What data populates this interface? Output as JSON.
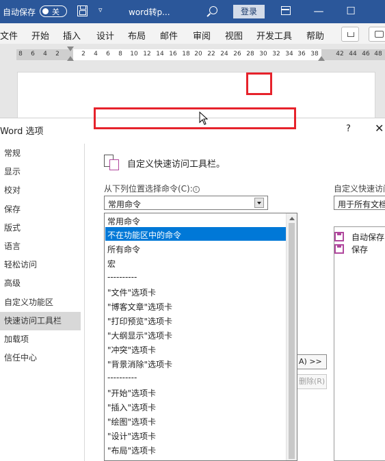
{
  "titlebar": {
    "autosave_label": "自动保存",
    "autosave_state": "关",
    "qat_dropdown": "▿",
    "doc_title": "word转p...",
    "login_label": "登录",
    "minimize": "—",
    "maximize": "☐",
    "bg_color": "#2b579a"
  },
  "menu": {
    "items": [
      "文件",
      "开始",
      "插入",
      "设计",
      "布局",
      "邮件",
      "审阅",
      "视图",
      "开发工具",
      "帮助"
    ]
  },
  "ruler": {
    "numbers": [
      "8",
      "6",
      "4",
      "2",
      "2",
      "4",
      "6",
      "8",
      "10",
      "12",
      "14",
      "16",
      "18",
      "20",
      "22",
      "24",
      "26",
      "28",
      "30",
      "32",
      "34",
      "36",
      "38",
      "42",
      "44",
      "46",
      "48"
    ]
  },
  "dialog": {
    "title": "Word 选项",
    "help": "?",
    "close": "✕",
    "nav": [
      "常规",
      "显示",
      "校对",
      "保存",
      "版式",
      "语言",
      "轻松访问",
      "高级",
      "自定义功能区",
      "快速访问工具栏",
      "加载项",
      "信任中心"
    ],
    "active_nav": "快速访问工具栏",
    "section_title": "自定义快速访问工具栏。",
    "choose_label": "从下列位置选择命令(C):",
    "combo_value": "常用命令",
    "dropdown_items": [
      "常用命令",
      "不在功能区中的命令",
      "所有命令",
      "宏",
      "----------",
      "\"文件\"选项卡",
      "\"博客文章\"选项卡",
      "\"打印预览\"选项卡",
      "\"大纲显示\"选项卡",
      "\"冲突\"选项卡",
      "\"背景消除\"选项卡",
      "----------",
      "\"开始\"选项卡",
      "\"插入\"选项卡",
      "\"绘图\"选项卡",
      "\"设计\"选项卡",
      "\"布局\"选项卡"
    ],
    "selected_item": "不在功能区中的命令",
    "right_label": "自定义快速访问",
    "right_combo": "用于所有文档",
    "right_list": [
      "自动保存",
      "保存"
    ],
    "add_button": "A) >>",
    "remove_button": "删除(R)",
    "highlight_color": "#e6222b",
    "selection_color": "#0078d7"
  }
}
